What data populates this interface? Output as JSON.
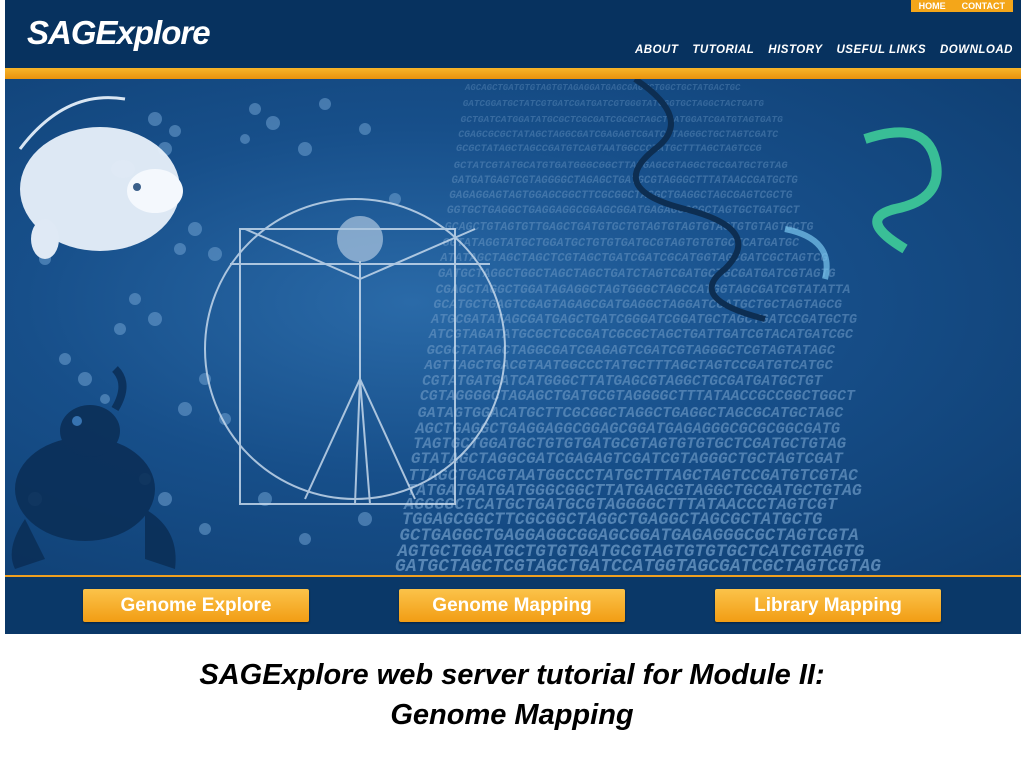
{
  "header": {
    "logo": "SAGExplore",
    "top_links": [
      "HOME",
      "CONTACT"
    ],
    "nav": [
      "ABOUT",
      "TUTORIAL",
      "HISTORY",
      "USEFUL LINKS",
      "DOWNLOAD"
    ]
  },
  "hero": {
    "dna_sequences": [
      "AGCAGCTGATGTGTAGTGTAGAGGATGAGCGAGTCTGGCTGCTATGACTGC",
      "GATCGGATGCTATCGTGATCGATGATCGTGGGTATCGGTGCTAGGCTACTGATG",
      "GCTGATCATGGATATGCGCTCGCGATCGCGCTAGCTCATGGATCGATGTAGTGATG",
      "CGAGCGCGCTATAGCTAGGCGATCGAGAGTCGATCGTAGGGCTGCTAGTCGATC",
      "GCGCTATAGCTAGCCGATGTCAGTAATGGCCCTATGCTTTAGCTAGTCCG",
      "GCTATCGTATGCATGTGATGGGCGGCTTATGAGCGTAGGCTGCGATGCTGTAG",
      "GATGATGAGTCGTAGGGGCTAGAGCTGATGCGTAGGGCTTTATAACCGATGCTG",
      "GAGAGGAGTAGTGGAGCGGCTTCGCGGCTAGGCTGAGGCTAGCGAGTCGCTG",
      "GGTGCTGAGGCTGAGGAGGCGGAGCGGATGAGAGGGCGCTAGTGCTGATGCT",
      "GCAGCTGTAGTGTTGAGCTGATGTGCTGTAGTGTAGTGTAGTGTGTAGTGCTG",
      "GGTATAGGTATGCTGGATGCTGTGTGATGCGTAGTGTGTGCTCATGATGC",
      "ATATAGCTAGCTAGCTCGTAGCTGATCGATCGCATGGTAGCGATCGCTAGTCG",
      "GATGCTAGGCTGGCTAGCTAGCTGATCTAGTCGATGCTGCGATGATCGTAGTG",
      "CGAGCTAGGCTGGATAGAGGCTAGTGGGCTAGCCATGGTAGCGATCGTATATTA",
      "GCATGCTGAGTCGAGTAGAGCGATGAGGCTAGGATCCATGCTGCTAGTAGCG",
      "ATGCGATATAGCGATGAGCTGATCGGGATCGGATGCTAGCTGATCCGATGCTG",
      "ATCGTAGATATGCGCTCGCGATCGCGCTAGCTGATTGATCGTACATGATCGC",
      "GCGCTATAGCTAGGCGATCGAGAGTCGATCGTAGGGCTCGTAGTATAGC",
      "AGTTAGCTGACGTAATGGCCCTATGCTTTAGCTAGTCCGATGTCATGC",
      "CGTATGATGATCATGGGCTTATGAGCGTAGGCTGCGATGATGCTGT",
      "CGTAGGGGCTAGAGCTGATGCGTAGGGGCTTTATAACCGCCGGCTGGCT",
      "GATAGTGGACATGCTTCGCGGCTAGGCTGAGGCTAGCGCATGCTAGC",
      "AGCTGAGGCTGAGGAGGCGGAGCGGATGAGAGGGCGCGCGGCGATG",
      "TAGTGCTGGATGCTGTGTGATGCGTAGTGTGTGCTCGATGCTGTAG",
      "GTATAGCTAGGCGATCGAGAGTCGATCGTAGGGCTGCTAGTCGAT",
      "TTAGCTGACGTAATGGCCCTATGCTTTAGCTAGTCCGATGTCGTAC",
      "TATGATGATGATGGGCGGCTTATGAGCGTAGGCTGCGATGCTGTAG",
      "AGGGGCTCATGCTGATGCGTAGGGGCTTTATAACCCTAGTCGT",
      "TGGAGCGGCTTCGCGGCTAGGCTGAGGCTAGCGCTATGCTG",
      "GCTGAGGCTGAGGAGGCGGAGCGGATGAGAGGGCGCTAGTCGTA",
      "AGTGCTGGATGCTGTGTGATGCGTAGTGTGTGCTCATCGTAGTG",
      "GATGCTAGCTCGTAGCTGATCCATGGTAGCGATCGCTAGTCGTAG"
    ]
  },
  "buttons": {
    "genome_explore": "Genome Explore",
    "genome_mapping": "Genome Mapping",
    "library_mapping": "Library Mapping"
  },
  "caption": {
    "line1": "SAGExplore web server tutorial for Module II:",
    "line2": "Genome Mapping"
  },
  "colors": {
    "header_bg": "#07325f",
    "accent_orange": "#f4a619",
    "button_orange": "#f29d14",
    "hero_blue": "#174f8a"
  }
}
